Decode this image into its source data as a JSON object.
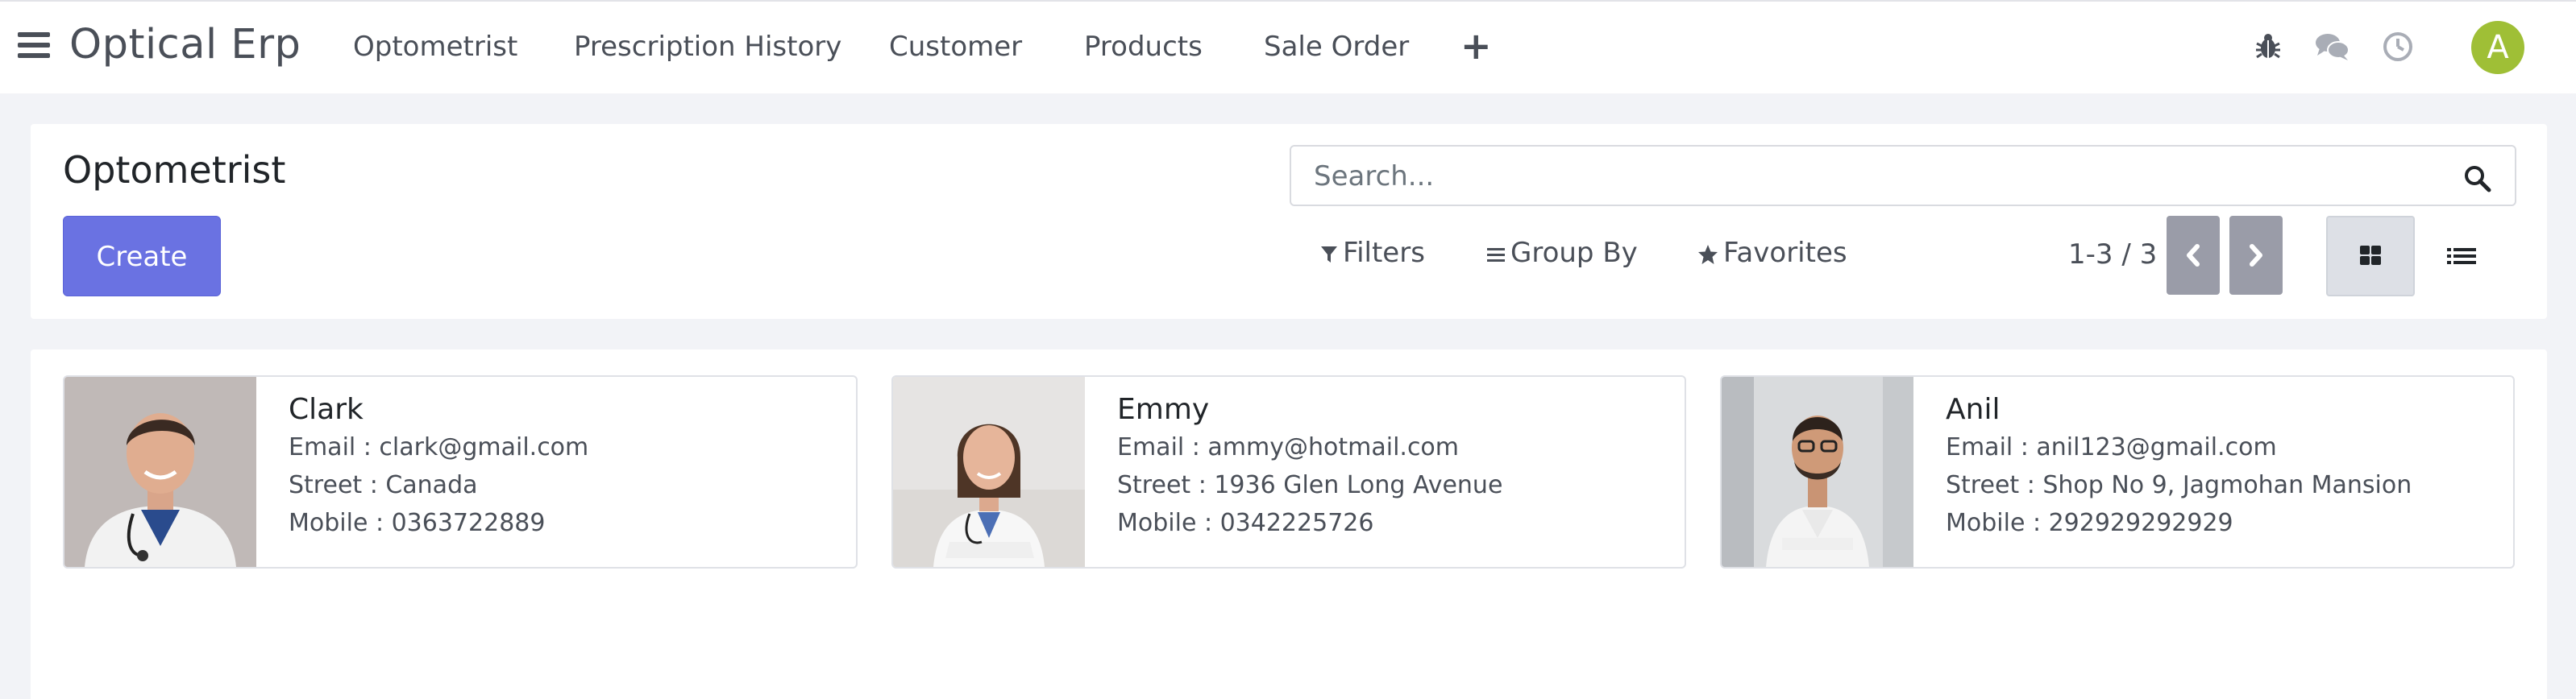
{
  "app": {
    "brand": "Optical Erp",
    "avatar_letter": "A",
    "accent_color": "#6a72e2",
    "avatar_color": "#9fbf36"
  },
  "nav": {
    "items": [
      {
        "label": "Optometrist"
      },
      {
        "label": "Prescription History"
      },
      {
        "label": "Customer"
      },
      {
        "label": "Products"
      },
      {
        "label": "Sale Order"
      }
    ],
    "add_icon": "plus-icon",
    "systray_icons": [
      "bug-icon",
      "chat-icon",
      "clock-icon"
    ]
  },
  "control_panel": {
    "title": "Optometrist",
    "create_label": "Create",
    "search_placeholder": "Search...",
    "filters_label": "Filters",
    "group_by_label": "Group By",
    "favorites_label": "Favorites",
    "pager": "1-3 / 3",
    "views": [
      "kanban-icon",
      "list-icon"
    ]
  },
  "cards": [
    {
      "name": "Clark",
      "email": "Email : clark@gmail.com",
      "street": "Street : Canada",
      "mobile": "Mobile : 0363722889"
    },
    {
      "name": "Emmy",
      "email": "Email : ammy@hotmail.com",
      "street": "Street : 1936 Glen Long Avenue",
      "mobile": "Mobile : 0342225726"
    },
    {
      "name": "Anil",
      "email": "Email : anil123@gmail.com",
      "street": "Street : Shop No 9, Jagmohan Mansion",
      "mobile": "Mobile : 292929292929"
    }
  ]
}
